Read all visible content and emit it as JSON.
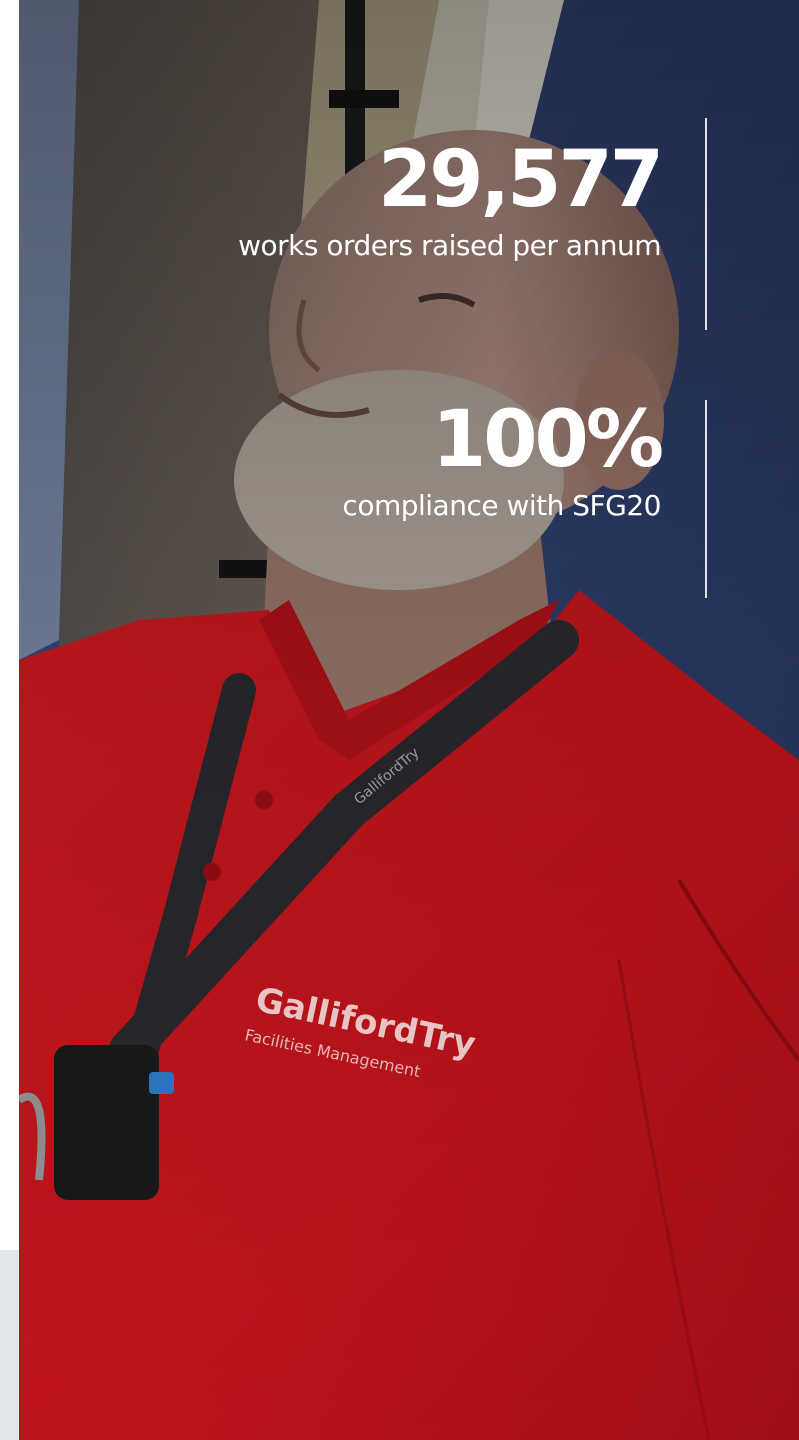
{
  "stats": [
    {
      "value": "29,577",
      "label": "works orders raised per annum"
    },
    {
      "value": "100%",
      "label": "compliance with SFG20"
    }
  ],
  "photo": {
    "shirt_logo_name": "GallifordTry",
    "shirt_logo_sub": "Facilities Management",
    "lanyard_text": "GallifordTry"
  },
  "colors": {
    "shirt_red": "#c8161e",
    "wall_blue": "#2e3f6c",
    "text": "#ffffff"
  }
}
